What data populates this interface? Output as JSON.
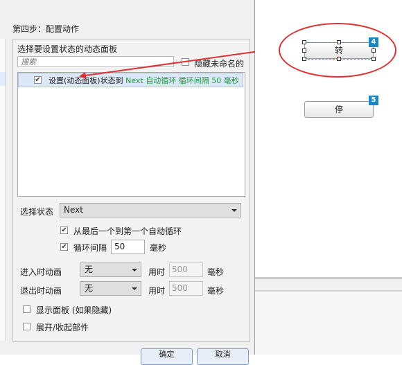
{
  "dialog": {
    "step_title": "第四步：配置动作",
    "panel_label": "选择要设置状态的动态面板",
    "search_placeholder": "搜索",
    "hide_unnamed_label": "隐藏未命名的",
    "list_item": {
      "prefix": "设置(动态面板)状态到 ",
      "highlight": "Next 自动循环 循环间隔 50 毫秒",
      "checked": true
    },
    "select_state_label": "选择状态",
    "select_state_value": "Next",
    "loop_label": "从最后一个到第一个自动循环",
    "interval_label": "循环间隔",
    "interval_value": "50",
    "interval_unit": "毫秒",
    "enter_anim_label": "进入时动画",
    "enter_anim_value": "无",
    "exit_anim_label": "退出时动画",
    "exit_anim_value": "无",
    "duration_label": "用时",
    "duration_value": "500",
    "duration_unit": "毫秒",
    "show_panel_label": "显示面板 (如果隐藏)",
    "expand_label": "展开/收起部件",
    "ok_label": "确定",
    "cancel_label": "取消"
  },
  "canvas": {
    "rotate_button_label": "转",
    "stop_button_label": "停",
    "badge_rotate": "4",
    "badge_stop": "5"
  },
  "colors": {
    "highlight_text": "#1b9a3a",
    "annotation_red": "#e03030",
    "badge_blue": "#1889c8",
    "selection_green": "#27b53f"
  }
}
